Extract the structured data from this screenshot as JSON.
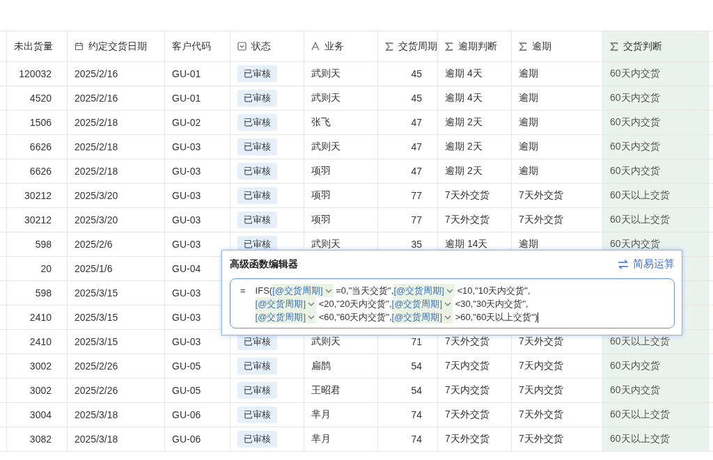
{
  "table": {
    "columns": [
      {
        "label": "未出货量",
        "kind": "number",
        "highlighted": false
      },
      {
        "label": "约定交货日期",
        "kind": "date",
        "highlighted": false
      },
      {
        "label": "客户代码",
        "kind": "text",
        "highlighted": false
      },
      {
        "label": "状态",
        "kind": "status",
        "highlighted": false
      },
      {
        "label": "业务",
        "kind": "person",
        "highlighted": false
      },
      {
        "label": "交货周期",
        "kind": "formula_number",
        "highlighted": false
      },
      {
        "label": "逾期判断",
        "kind": "formula",
        "highlighted": false
      },
      {
        "label": "逾期",
        "kind": "formula",
        "highlighted": false
      },
      {
        "label": "交货判断",
        "kind": "formula",
        "highlighted": true
      }
    ],
    "rows": [
      {
        "cells": [
          "120032",
          "2025/2/16",
          "GU-01",
          "已审核",
          "武则天",
          "45",
          "逾期 4天",
          "逾期",
          "60天内交货"
        ]
      },
      {
        "cells": [
          "4520",
          "2025/2/16",
          "GU-01",
          "已审核",
          "武则天",
          "45",
          "逾期 4天",
          "逾期",
          "60天内交货"
        ]
      },
      {
        "cells": [
          "1506",
          "2025/2/18",
          "GU-02",
          "已审核",
          "张飞",
          "47",
          "逾期 2天",
          "逾期",
          "60天内交货"
        ]
      },
      {
        "cells": [
          "6626",
          "2025/2/18",
          "GU-03",
          "已审核",
          "武则天",
          "47",
          "逾期 2天",
          "逾期",
          "60天内交货"
        ]
      },
      {
        "cells": [
          "6626",
          "2025/2/18",
          "GU-03",
          "已审核",
          "项羽",
          "47",
          "逾期 2天",
          "逾期",
          "60天内交货"
        ]
      },
      {
        "cells": [
          "30212",
          "2025/3/20",
          "GU-03",
          "已审核",
          "项羽",
          "77",
          "7天外交货",
          "7天外交货",
          "60天以上交货"
        ]
      },
      {
        "cells": [
          "30212",
          "2025/3/20",
          "GU-03",
          "已审核",
          "项羽",
          "77",
          "7天外交货",
          "7天外交货",
          "60天以上交货"
        ]
      },
      {
        "cells": [
          "598",
          "2025/2/6",
          "GU-03",
          "已审核",
          "武则天",
          "35",
          "逾期 14天",
          "逾期",
          "60天内交货"
        ]
      },
      {
        "cells": [
          "20",
          "2025/1/6",
          "GU-04"
        ]
      },
      {
        "cells": [
          "598",
          "2025/3/15",
          "GU-03"
        ]
      },
      {
        "cells": [
          "2410",
          "2025/3/15",
          "GU-03"
        ]
      },
      {
        "cells": [
          "2410",
          "2025/3/15",
          "GU-03",
          "已审核",
          "武则天",
          "71",
          "7天外交货",
          "7天外交货",
          "60天以上交货"
        ]
      },
      {
        "cells": [
          "3002",
          "2025/2/26",
          "GU-05",
          "已审核",
          "扁鹊",
          "54",
          "7天内交货",
          "7天内交货",
          "60天内交货"
        ]
      },
      {
        "cells": [
          "3002",
          "2025/2/26",
          "GU-05",
          "已审核",
          "王昭君",
          "54",
          "7天内交货",
          "7天内交货",
          "60天内交货"
        ]
      },
      {
        "cells": [
          "3004",
          "2025/3/18",
          "GU-06",
          "已审核",
          "芈月",
          "74",
          "7天外交货",
          "7天外交货",
          "60天以上交货"
        ]
      },
      {
        "cells": [
          "3082",
          "2025/3/18",
          "GU-06",
          "已审核",
          "芈月",
          "74",
          "7天外交货",
          "7天外交货",
          "60天以上交货"
        ]
      }
    ]
  },
  "formula_editor": {
    "title": "高级函数编辑器",
    "mode_link": "简易运算",
    "equals": "=",
    "focused": true,
    "parts": [
      {
        "kind": "text",
        "text": "IFS("
      },
      {
        "kind": "field",
        "text": "[@交货周期]"
      },
      {
        "kind": "text",
        "text": "=0,\"当天交货\","
      },
      {
        "kind": "field",
        "text": "[@交货周期]"
      },
      {
        "kind": "text",
        "text": "<10,\"10天内交货\","
      },
      {
        "kind": "field",
        "text": "[@交货周期]"
      },
      {
        "kind": "text",
        "text": "<20,\"20天内交货\","
      },
      {
        "kind": "field",
        "text": "[@交货周期]"
      },
      {
        "kind": "text",
        "text": "<30,\"30天内交货\","
      },
      {
        "kind": "field",
        "text": "[@交货周期]"
      },
      {
        "kind": "text",
        "text": "<60,\"60天内交货\","
      },
      {
        "kind": "field",
        "text": "[@交货周期]"
      },
      {
        "kind": "text",
        "text": ">60,\"60天以上交货\")"
      }
    ]
  }
}
